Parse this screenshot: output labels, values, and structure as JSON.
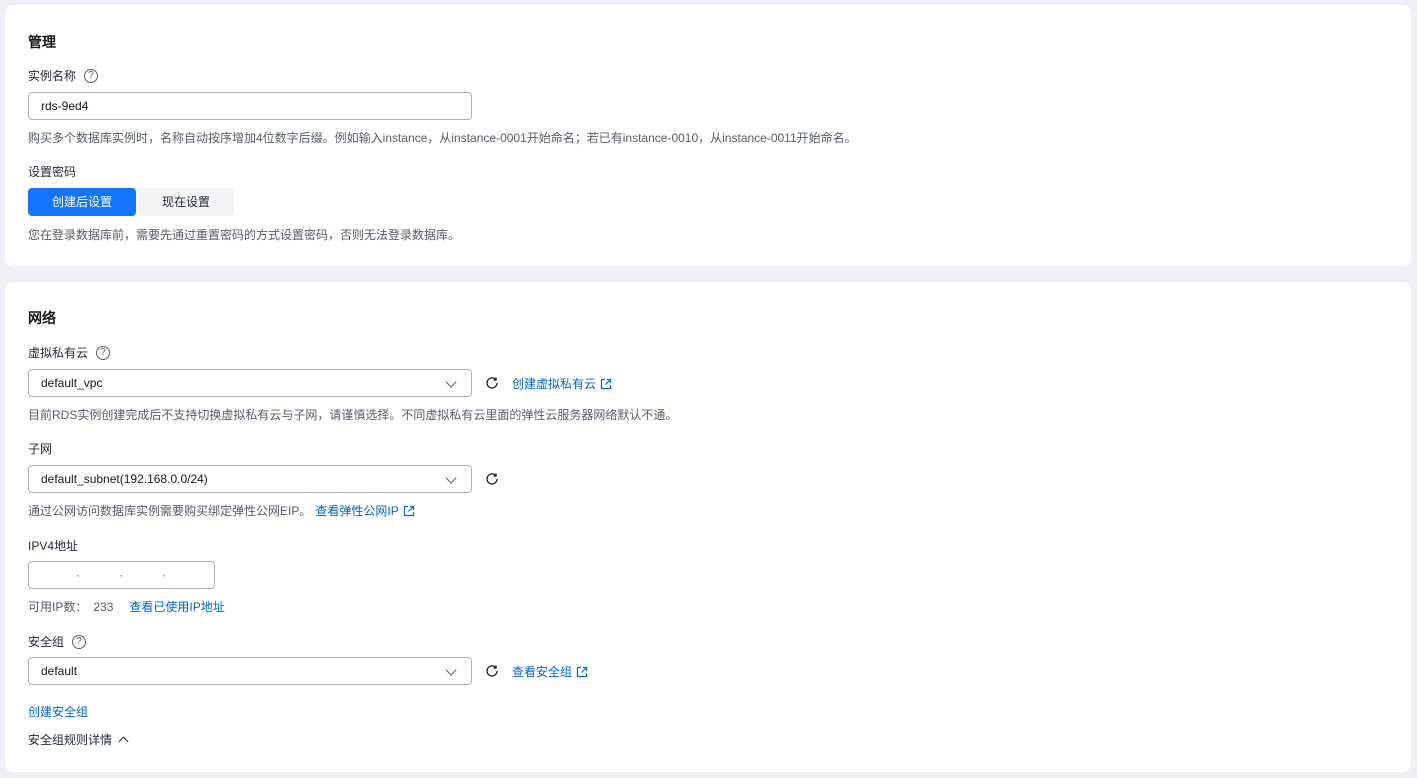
{
  "manage": {
    "title": "管理",
    "instance_name_label": "实例名称",
    "instance_name_value": "rds-9ed4",
    "instance_name_hint": "购买多个数据库实例时，名称自动按序增加4位数字后缀。例如输入instance，从instance-0001开始命名；若已有instance-0010，从instance-0011开始命名。",
    "password_label": "设置密码",
    "password_options": [
      "创建后设置",
      "现在设置"
    ],
    "password_selected": "创建后设置",
    "password_hint": "您在登录数据库前，需要先通过重置密码的方式设置密码，否则无法登录数据库。"
  },
  "network": {
    "title": "网络",
    "vpc_label": "虚拟私有云",
    "vpc_value": "default_vpc",
    "vpc_create_link": "创建虚拟私有云",
    "vpc_hint": "目前RDS实例创建完成后不支持切换虚拟私有云与子网，请谨慎选择。不同虚拟私有云里面的弹性云服务器网络默认不通。",
    "subnet_label": "子网",
    "subnet_value": "default_subnet(192.168.0.0/24)",
    "subnet_hint": "通过公网访问数据库实例需要购买绑定弹性公网EIP。",
    "subnet_eip_link": "查看弹性公网IP",
    "ipv4_label": "IPV4地址",
    "available_ip_label": "可用IP数：",
    "available_ip_count": "233",
    "view_used_ip_link": "查看已使用IP地址",
    "sg_label": "安全组",
    "sg_value": "default",
    "sg_view_link": "查看安全组",
    "sg_create_link": "创建安全组",
    "sg_rules_toggle": "安全组规则详情"
  },
  "colors": {
    "primary": "#1476ff",
    "link": "#0066d9",
    "background": "#eef0f5"
  }
}
